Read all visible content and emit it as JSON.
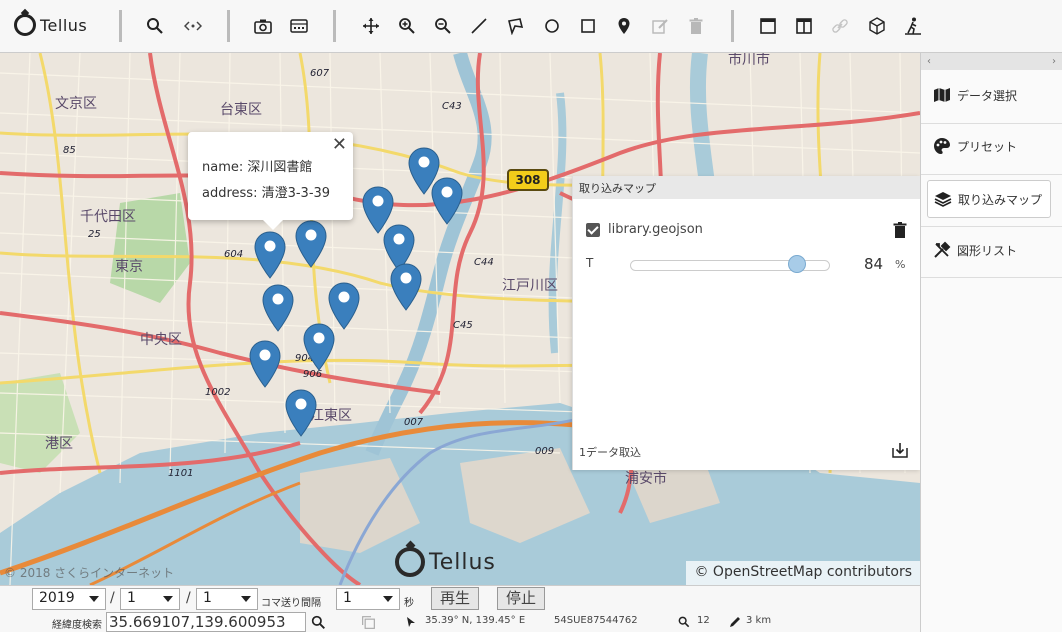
{
  "app": {
    "logo_text": "Tellus"
  },
  "toolbar": {
    "buttons": [
      {
        "name": "search-icon"
      },
      {
        "name": "code-icon"
      },
      {
        "name": "camera-icon"
      },
      {
        "name": "keyboard-icon"
      },
      {
        "name": "pan-icon"
      },
      {
        "name": "zoom-in-icon"
      },
      {
        "name": "zoom-out-icon"
      },
      {
        "name": "line-icon"
      },
      {
        "name": "polygon-icon"
      },
      {
        "name": "circle-icon"
      },
      {
        "name": "rectangle-icon"
      },
      {
        "name": "marker-icon"
      },
      {
        "name": "edit-icon"
      },
      {
        "name": "delete-icon"
      },
      {
        "name": "window-icon"
      },
      {
        "name": "split-icon"
      },
      {
        "name": "link-icon"
      },
      {
        "name": "cube-icon"
      },
      {
        "name": "walker-icon"
      }
    ]
  },
  "map": {
    "popup": {
      "name_line": "name: 深川図書館",
      "address_line": "address: 清澄3-3-39",
      "close": "✕"
    },
    "labels": [
      "文京区",
      "台東区",
      "千代田区",
      "東京",
      "中央区",
      "江東区",
      "港区",
      "江戸川区",
      "浦安市",
      "市川市"
    ],
    "road_numbers": [
      "607",
      "C43",
      "604",
      "904",
      "906",
      "C44",
      "C45",
      "1002",
      "007",
      "009",
      "1101",
      "85",
      "25"
    ],
    "route_badge": "308",
    "attribution": "© OpenStreetMap contributors",
    "copyright": "© 2018 さくらインターネット",
    "watermark_text": "Tellus",
    "marker_count": 12
  },
  "import_panel": {
    "title": "取り込みマップ",
    "layer_name": "library.geojson",
    "opacity_label": "T",
    "opacity_value": "84",
    "opacity_unit": "%",
    "status": "1データ取込"
  },
  "sidebar": {
    "collapse_left": "‹",
    "collapse_right": "›",
    "items": [
      {
        "label": "データ選択",
        "icon": "map-icon"
      },
      {
        "label": "プリセット",
        "icon": "palette-icon"
      },
      {
        "label": "取り込みマップ",
        "icon": "layers-icon"
      },
      {
        "label": "図形リスト",
        "icon": "tools-icon"
      }
    ]
  },
  "bottombar": {
    "year": "2019",
    "month": "1",
    "day": "1",
    "slash": "/",
    "frame_interval_label": "コマ送り間隔",
    "interval_value": "1",
    "seconds_label": "秒",
    "play_label": "再生",
    "stop_label": "停止",
    "latlon_search_label": "経緯度検索",
    "coord_value": "35.669107,139.600953",
    "cursor_latlon": "35.39° N, 139.45° E",
    "mesh_code": "54SUE87544762",
    "zoom_level": "12",
    "scale": "3 km"
  }
}
